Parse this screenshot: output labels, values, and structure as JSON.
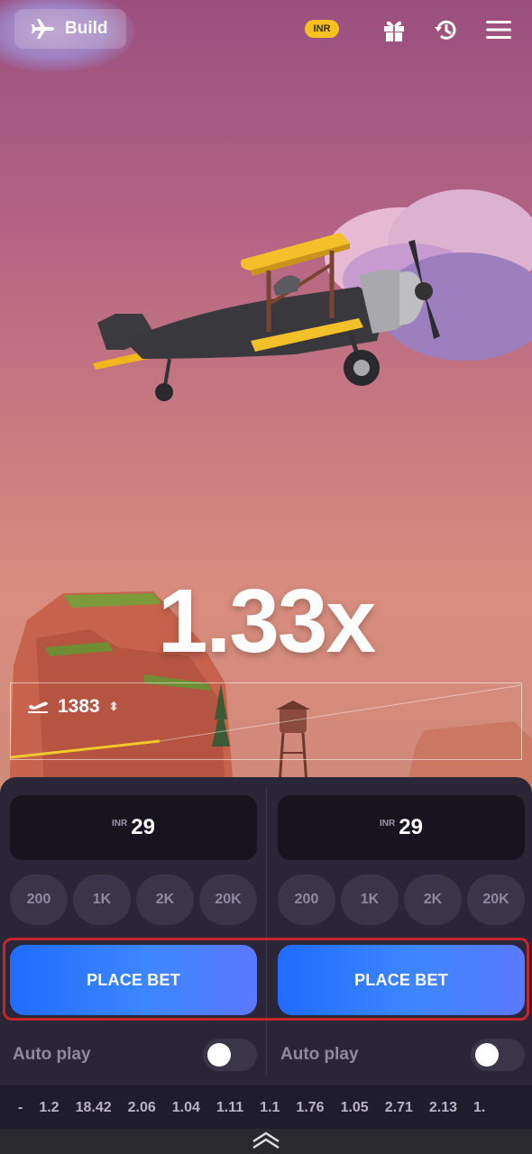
{
  "topbar": {
    "build_label": "Build",
    "currency_badge": "INR",
    "icons": [
      "airplane-icon",
      "gift-icon",
      "history-icon",
      "menu-icon"
    ]
  },
  "game": {
    "multiplier": "1.33x",
    "players_count": "1383"
  },
  "bets": [
    {
      "currency": "INR",
      "amount": "29",
      "chips": [
        "200",
        "1K",
        "2K",
        "20K"
      ],
      "place_label": "PLACE BET",
      "autoplay_label": "Auto play",
      "autoplay_on": false
    },
    {
      "currency": "INR",
      "amount": "29",
      "chips": [
        "200",
        "1K",
        "2K",
        "20K"
      ],
      "place_label": "PLACE BET",
      "autoplay_label": "Auto play",
      "autoplay_on": false
    }
  ],
  "history": [
    "-",
    "1.2",
    "18.42",
    "2.06",
    "1.04",
    "1.11",
    "1.1",
    "1.76",
    "1.05",
    "2.71",
    "2.13",
    "1."
  ],
  "colors": {
    "accent_blue": "#3d86ff",
    "badge_yellow": "#f6c01f",
    "highlight_red": "#c8232a",
    "panel_bg": "#2a2637"
  }
}
